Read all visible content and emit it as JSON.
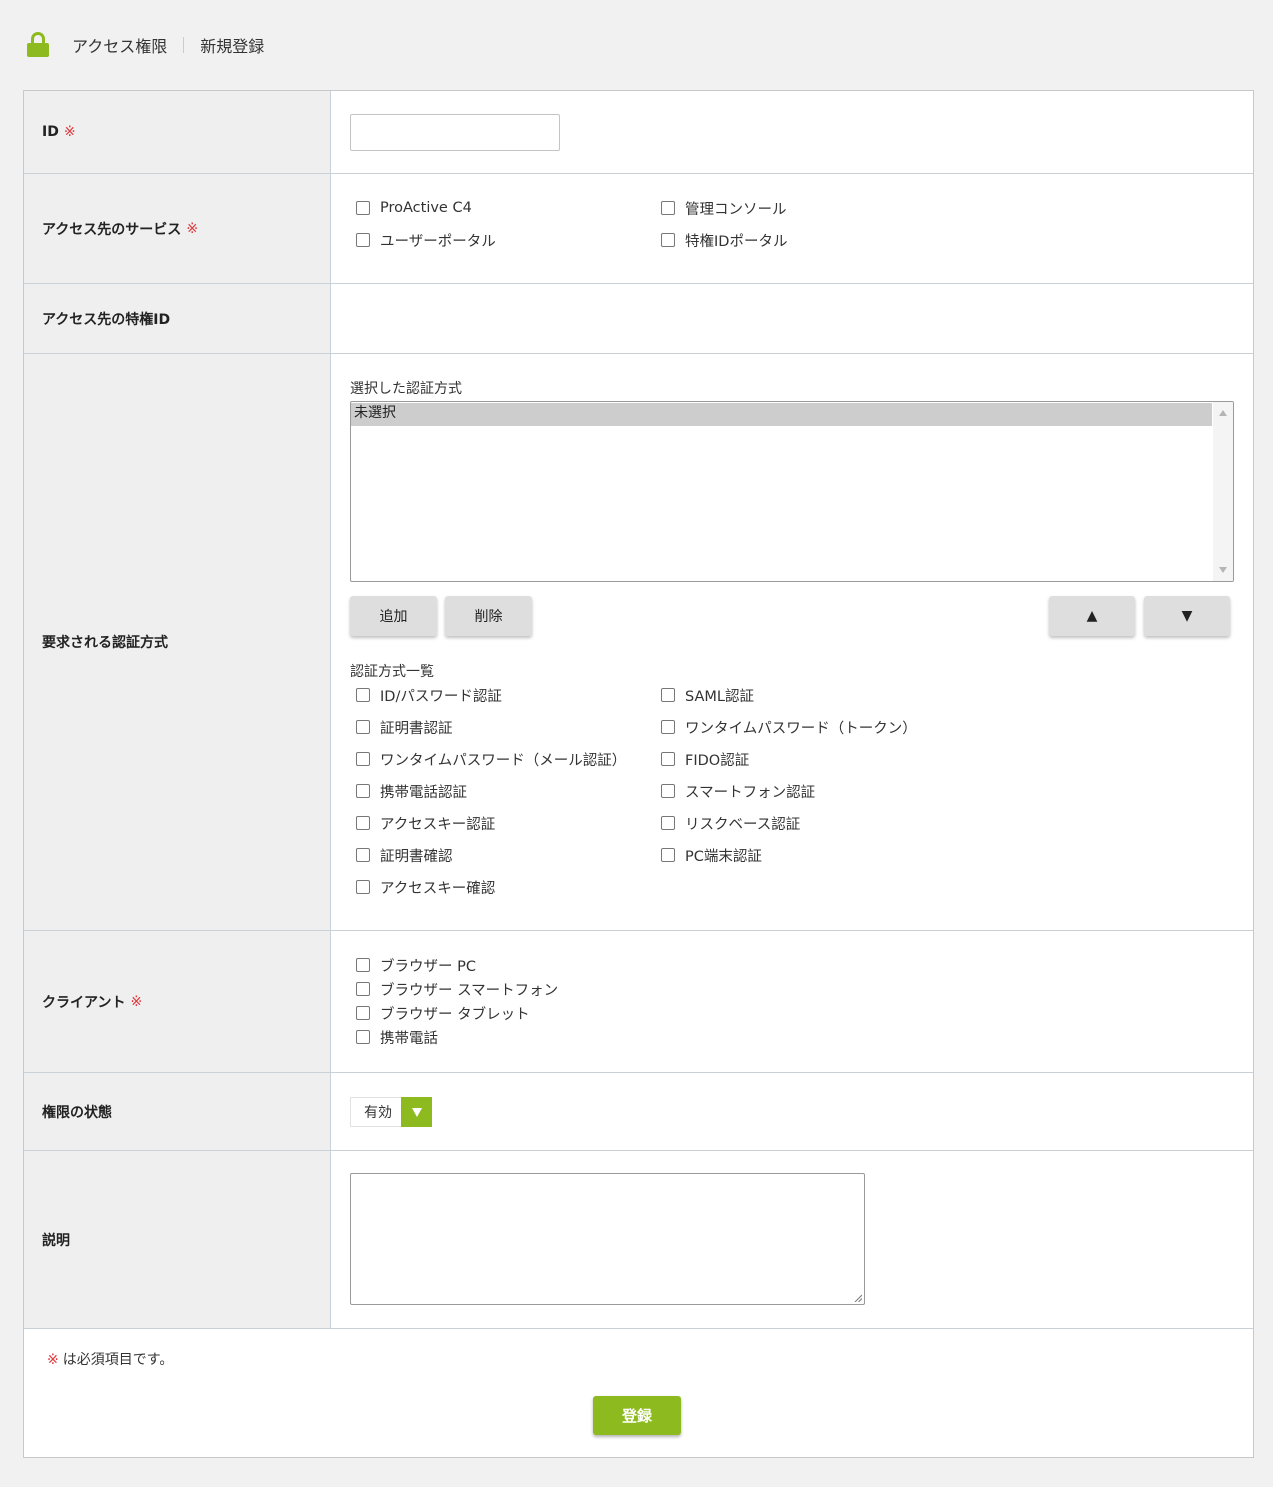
{
  "header": {
    "section": "アクセス権限",
    "page": "新規登録"
  },
  "required_mark": "※",
  "form": {
    "id": {
      "label": "ID",
      "value": ""
    },
    "services": {
      "label": "アクセス先のサービス",
      "options": [
        "ProActive C4",
        "管理コンソール",
        "ユーザーポータル",
        "特権IDポータル"
      ]
    },
    "privileged_id": {
      "label": "アクセス先の特権ID"
    },
    "auth": {
      "label": "要求される認証方式",
      "selected_label": "選択した認証方式",
      "selected_items": [
        "未選択"
      ],
      "add_button": "追加",
      "delete_button": "削除",
      "up_button": "▲",
      "down_button": "▼",
      "list_label": "認証方式一覧",
      "methods": [
        "ID/パスワード認証",
        "SAML認証",
        "証明書認証",
        "ワンタイムパスワード（トークン）",
        "ワンタイムパスワード（メール認証）",
        "FIDO認証",
        "携帯電話認証",
        "スマートフォン認証",
        "アクセスキー認証",
        "リスクベース認証",
        "証明書確認",
        "PC端末認証",
        "アクセスキー確認"
      ]
    },
    "client": {
      "label": "クライアント",
      "options": [
        "ブラウザー PC",
        "ブラウザー スマートフォン",
        "ブラウザー タブレット",
        "携帯電話"
      ]
    },
    "status": {
      "label": "権限の状態",
      "value": "有効"
    },
    "description": {
      "label": "説明",
      "value": ""
    }
  },
  "footnote": "は必須項目です。",
  "submit_label": "登録",
  "colors": {
    "accent": "#8dba1f",
    "required": "#e0393e"
  }
}
